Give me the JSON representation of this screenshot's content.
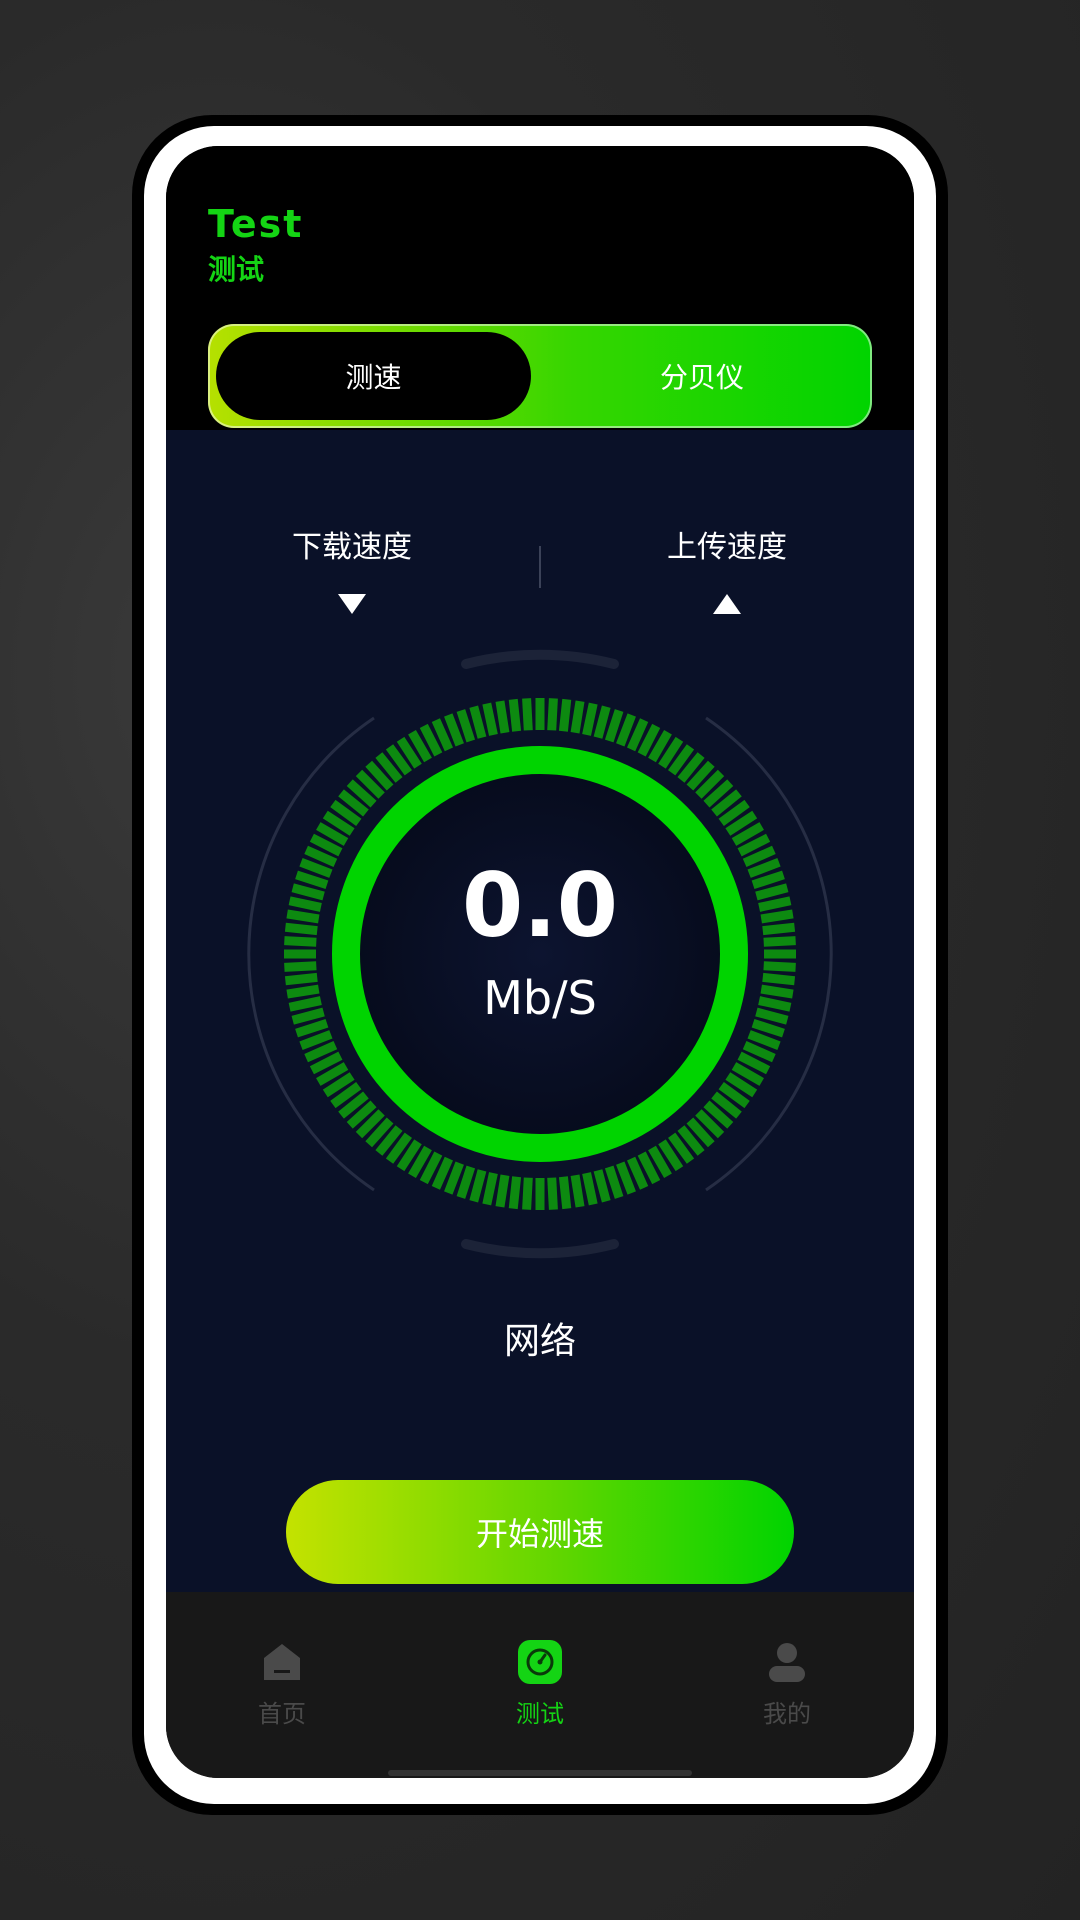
{
  "header": {
    "title_en": "Test",
    "title_zh": "测试"
  },
  "segment": {
    "active_label": "测速",
    "inactive_label": "分贝仪"
  },
  "metrics": {
    "download_label": "下载速度",
    "upload_label": "上传速度"
  },
  "gauge": {
    "value": "0.0",
    "unit": "Mb/S"
  },
  "network_label": "网络",
  "start_button_label": "开始测速",
  "tabbar": {
    "items": [
      {
        "label": "首页",
        "icon": "home-icon",
        "active": false
      },
      {
        "label": "测试",
        "icon": "speedometer-icon",
        "active": true
      },
      {
        "label": "我的",
        "icon": "user-icon",
        "active": false
      }
    ]
  },
  "colors": {
    "accent_green": "#14d414",
    "panel_bg": "#0a1128",
    "gradient_start": "#c4e200",
    "gradient_end": "#00d400",
    "tick_green": "#0d8a10"
  }
}
